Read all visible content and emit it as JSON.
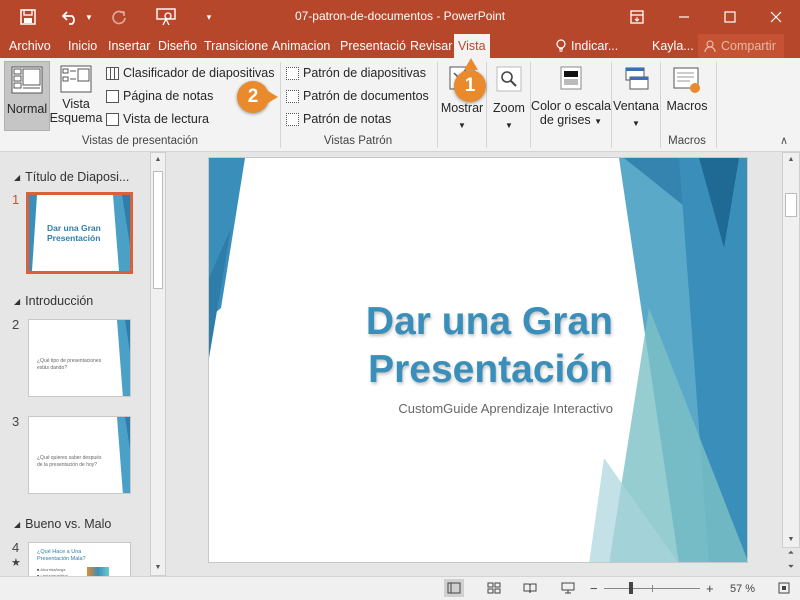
{
  "window": {
    "title": "07-patron-de-documentos - PowerPoint",
    "title_bg": "#b7472a"
  },
  "qat": {
    "save_icon": "save-icon",
    "undo_icon": "undo-icon",
    "redo_icon": "redo-icon",
    "present_icon": "present-from-start-icon",
    "customize_icon": "customize-qat-icon"
  },
  "tabs": [
    "Archivo",
    "Inicio",
    "Insertar",
    "Diseño",
    "Transicione",
    "Animacion",
    "Presentació",
    "Revisar",
    "Vista"
  ],
  "active_tab": "Vista",
  "tell_me": "Indicar...",
  "user": "Kayla...",
  "share": "Compartir",
  "ribbon": {
    "vistas_presentacion": {
      "label": "Vistas de presentación",
      "normal": "Normal",
      "esquema_line1": "Vista",
      "esquema_line2": "Esquema",
      "clasificador": "Clasificador de diapositivas",
      "pagina_notas": "Página de notas",
      "vista_lectura": "Vista de lectura"
    },
    "vistas_patron": {
      "label": "Vistas Patrón",
      "patron_diapositivas": "Patrón de diapositivas",
      "patron_documentos": "Patrón de documentos",
      "patron_notas": "Patrón de notas"
    },
    "mostrar": "Mostrar",
    "zoom": "Zoom",
    "color_line1": "Color o escala",
    "color_line2": "de grises",
    "ventana": "Ventana",
    "macros": "Macros",
    "macros_group": "Macros"
  },
  "badges": {
    "one": "1",
    "two": "2",
    "color": "#e98a2c"
  },
  "slides_pane": {
    "sections": [
      "Título de Diaposi...",
      "Introducción",
      "Bueno vs. Malo"
    ],
    "slides": [
      {
        "num": "1",
        "title_l1": "Dar una Gran",
        "title_l2": "Presentación",
        "selected": true
      },
      {
        "num": "2",
        "text_l1": "¿Qué tipo de presentaciones",
        "text_l2": "estás dando?"
      },
      {
        "num": "3",
        "text_l1": "¿Qué quieres saber después",
        "text_l2": "de la presentación de hoy?"
      },
      {
        "num": "4",
        "text_l1": "¿Qué Hace a Una",
        "text_l2": "Presentación Mala?",
        "bullet1": "■ Aburrida/larga",
        "bullet2": "■ Lenta/repetitiva"
      }
    ]
  },
  "slide": {
    "title_line1": "Dar una Gran",
    "title_line2": "Presentación",
    "subtitle": "CustomGuide Aprendizaje Interactivo",
    "accent_color": "#3a8fba"
  },
  "status": {
    "zoom": "57 %",
    "minus": "−",
    "plus": "+"
  }
}
